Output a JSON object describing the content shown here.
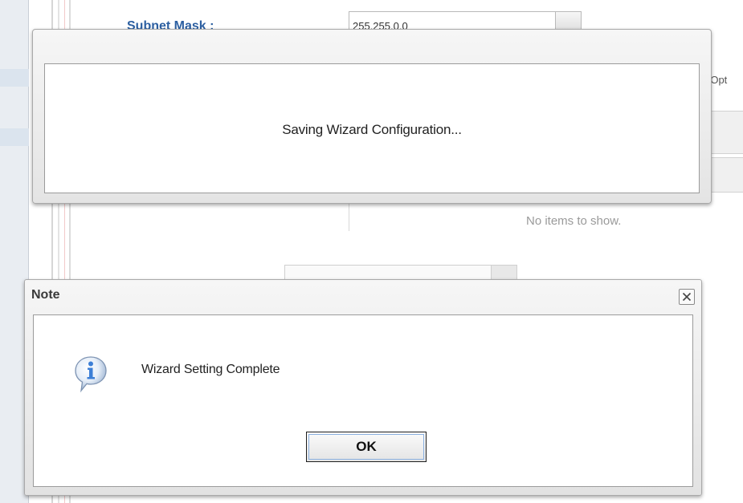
{
  "background": {
    "subnet_label": "Subnet Mask :",
    "subnet_value": "255.255.0.0",
    "optional_fragment": "(Opt",
    "grid_empty_text": "No items to show."
  },
  "saving_dialog": {
    "message": "Saving Wizard Configuration..."
  },
  "note_dialog": {
    "title": "Note",
    "message": "Wizard Setting Complete",
    "ok_label": "OK",
    "icon": "info-balloon-icon",
    "close_icon": "close-icon"
  },
  "colors": {
    "label_blue": "#2c5fa1",
    "info_icon_blue": "#3d7fd6",
    "ok_focus_ring": "#8ab0e0"
  }
}
